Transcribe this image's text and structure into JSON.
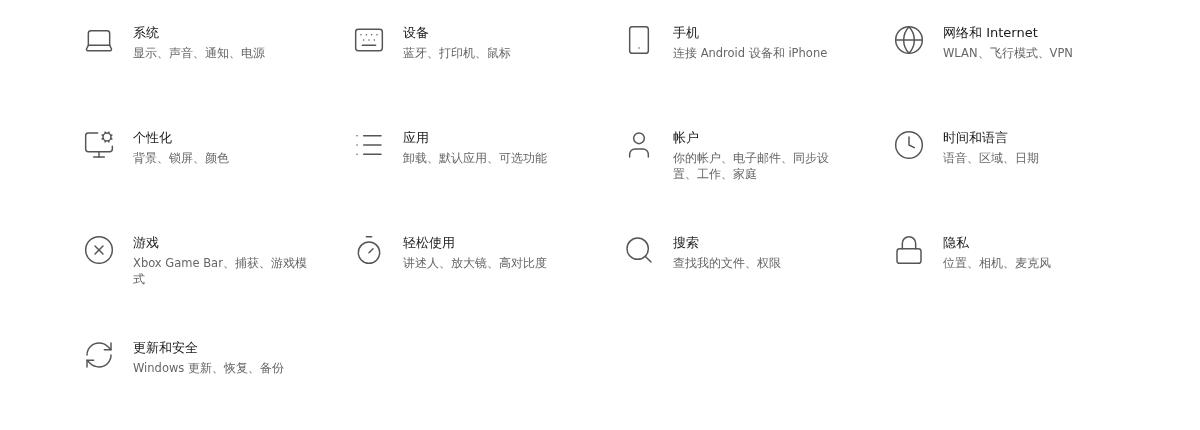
{
  "tiles": [
    {
      "kind": "laptop",
      "title": "系统",
      "subtitle": "显示、声音、通知、电源"
    },
    {
      "kind": "devices",
      "title": "设备",
      "subtitle": "蓝牙、打印机、鼠标"
    },
    {
      "kind": "phone",
      "title": "手机",
      "subtitle": "连接 Android 设备和 iPhone"
    },
    {
      "kind": "globe",
      "title": "网络和 Internet",
      "subtitle": "WLAN、飞行模式、VPN"
    },
    {
      "kind": "personalize",
      "title": "个性化",
      "subtitle": "背景、锁屏、颜色"
    },
    {
      "kind": "apps",
      "title": "应用",
      "subtitle": "卸载、默认应用、可选功能"
    },
    {
      "kind": "person",
      "title": "帐户",
      "subtitle": "你的帐户、电子邮件、同步设置、工作、家庭"
    },
    {
      "kind": "clock",
      "title": "时间和语言",
      "subtitle": "语音、区域、日期"
    },
    {
      "kind": "xbox",
      "title": "游戏",
      "subtitle": "Xbox Game Bar、捕获、游戏模式"
    },
    {
      "kind": "ease",
      "title": "轻松使用",
      "subtitle": "讲述人、放大镜、高对比度"
    },
    {
      "kind": "search",
      "title": "搜索",
      "subtitle": "查找我的文件、权限"
    },
    {
      "kind": "lock",
      "title": "隐私",
      "subtitle": "位置、相机、麦克风"
    },
    {
      "kind": "sync",
      "title": "更新和安全",
      "subtitle": "Windows 更新、恢复、备份"
    }
  ]
}
